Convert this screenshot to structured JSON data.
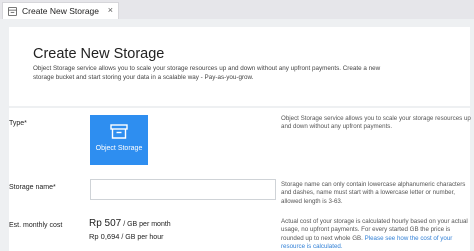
{
  "tab": {
    "title": "Create New Storage",
    "icon": "storage-icon",
    "close_label": "×"
  },
  "header": {
    "title": "Create New Storage",
    "description": "Object Storage service allows you to scale your storage resources up and down without any upfront payments. Create a new storage bucket and start storing your data in a scalable way - Pay-as-you-grow."
  },
  "form": {
    "type": {
      "label": "Type*",
      "option_label": "Object Storage",
      "option_icon": "storage-box-icon",
      "help": "Object Storage service allows you to scale your storage resources up and down without any upfront payments."
    },
    "storage_name": {
      "label": "Storage name*",
      "value": "",
      "placeholder": "",
      "help": "Storage name can only contain lowercase alphanumeric characters and dashes, name must start with a lowercase letter or number, allowed length is 3-63."
    },
    "cost": {
      "label": "Est. monthly cost",
      "monthly_amount": "Rp 507",
      "monthly_unit": "/ GB per month",
      "hourly_amount": "Rp 0,694",
      "hourly_unit": "/ GB per hour",
      "help_text": "Actual cost of your storage is calculated hourly based on your actual usage, no upfront payments. For every started GB the price is rounded up to next whole GB.",
      "help_link": "Please see how the cost of your resource is calculated."
    }
  },
  "colors": {
    "accent": "#2e8ef0",
    "link": "#2f7fd6",
    "background": "#eef0f2"
  }
}
